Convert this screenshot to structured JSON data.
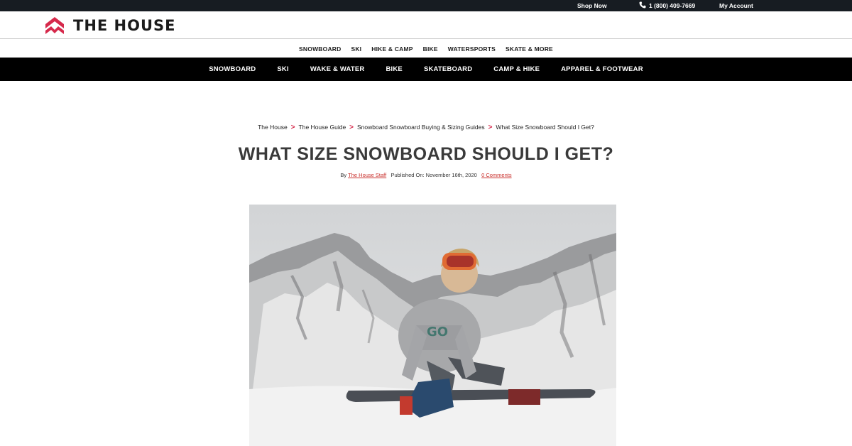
{
  "topbar": {
    "shop_now": "Shop Now",
    "phone": "1 (800) 409-7669",
    "my_account": "My Account"
  },
  "header": {
    "logo_text": "THE HOUSE",
    "logo_icon": "house-mountain-logo"
  },
  "nav_primary": [
    "SNOWBOARD",
    "SKI",
    "HIKE & CAMP",
    "BIKE",
    "WATERSPORTS",
    "SKATE & MORE"
  ],
  "nav_secondary": [
    "SNOWBOARD",
    "SKI",
    "WAKE & WATER",
    "BIKE",
    "SKATEBOARD",
    "CAMP & HIKE",
    "APPAREL & FOOTWEAR"
  ],
  "breadcrumb": {
    "items": [
      "The House",
      "The House Guide",
      "Snowboard Snowboard Buying & Sizing Guides",
      "What Size Snowboard Should I Get?"
    ],
    "separator": ">"
  },
  "article": {
    "title": "WHAT SIZE SNOWBOARD SHOULD I GET?",
    "by_label": "By",
    "author": "The House Staff",
    "published_label": "Published On: November 16th, 2020",
    "comments": "0 Comments"
  },
  "colors": {
    "accent": "#d6294b",
    "topbar_bg": "#171c22",
    "nav_secondary_bg": "#000000"
  }
}
